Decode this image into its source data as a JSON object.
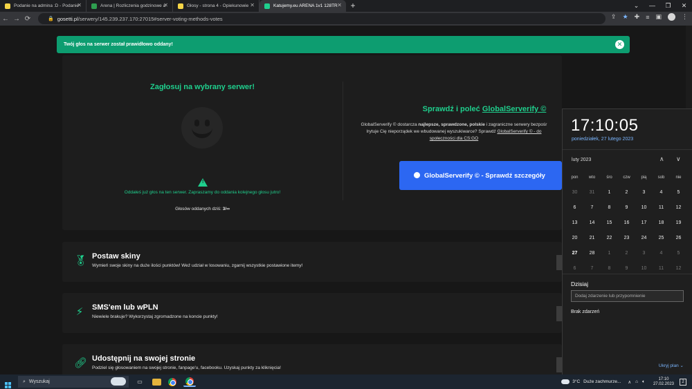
{
  "browser": {
    "tabs": [
      {
        "title": "Podanie na admina :D - Podanie",
        "favicon_color": "#f5d547",
        "active": false
      },
      {
        "title": "Arena | Rozliczenia godzinowe a",
        "favicon_color": "#2e9e4f",
        "active": false
      },
      {
        "title": "Głosy - strona 4 - Opiekunowie",
        "favicon_color": "#f5d547",
        "active": false
      },
      {
        "title": "Katujemy.eu ARENA 1v1 128TR",
        "favicon_color": "#1fcf8d",
        "active": true
      }
    ],
    "new_tab": "+",
    "url_host": "gosetti.pl",
    "url_path": "/serwery/145.239.237.170:27015#server-voting-methods-votes"
  },
  "notice": {
    "text": "Twój głos na serwer został prawidłowo oddany!",
    "close": "✕"
  },
  "vote": {
    "heading": "Zagłosuj na wybrany serwer!",
    "already_voted": "Oddałeś już głos na ten serwer. Zapraszamy do oddania kolejnego głosu jutro!",
    "count_label": "Głosów oddanych dziś:",
    "count_value": "3/∞",
    "warn_symbol": "!"
  },
  "globalserverify": {
    "title_prefix": "Sprawdź i poleć",
    "title_link": "GlobalServerify ©",
    "desc_line1_a": "GlobalServerify © dostarcza ",
    "desc_line1_b": "najlepsze, sprawdzone, polskie",
    "desc_line1_c": " i zagraniczne serwery bezpośr",
    "desc_line2_a": "Irytuje Cię nieporządek we wbudowanej wyszukiwarce? Sprawdź ",
    "desc_line2_b": "GlobalServerify © - do",
    "desc_line3": "społeczności dla CS:GO",
    "button": "GlobalServerify © - Sprawdź szczegóły"
  },
  "features": [
    {
      "title": "Postaw skiny",
      "desc": "Wymień swoje skiny na duże ilości punktów! Weź udział w losowaniu, zgarnij wszystkie postawione itemy!",
      "icon": "award-icon"
    },
    {
      "title": "SMS'em lub wPLN",
      "desc": "Niewiele brakuje? Wykorzystaj zgromadzone na koncie punkty!",
      "icon": "lightning-icon"
    },
    {
      "title": "Udostępnij na swojej stronie",
      "desc": "Podziel się głosowaniem na swojej stronie, fanpage'u, facebooku. Uzyskaj punkty za kliknięcia!",
      "icon": "link-icon"
    }
  ],
  "calendar_flyout": {
    "time": "17:10:05",
    "date": "poniedziałek, 27 lutego 2023",
    "month": "luty 2023",
    "weekdays": [
      "pon",
      "wto",
      "śro",
      "czw",
      "pią",
      "sob",
      "nie"
    ],
    "weeks": [
      [
        "30",
        "31",
        "1",
        "2",
        "3",
        "4",
        "5"
      ],
      [
        "6",
        "7",
        "8",
        "9",
        "10",
        "11",
        "12"
      ],
      [
        "13",
        "14",
        "15",
        "16",
        "17",
        "18",
        "19"
      ],
      [
        "20",
        "21",
        "22",
        "23",
        "24",
        "25",
        "26"
      ],
      [
        "27",
        "28",
        "1",
        "2",
        "3",
        "4",
        "5"
      ],
      [
        "6",
        "7",
        "8",
        "9",
        "10",
        "11",
        "12"
      ]
    ],
    "today_label": "Dzisiaj",
    "event_placeholder": "Dodaj zdarzenie lub przypomnienie",
    "no_events": "Brak zdarzeń",
    "hide_plan": "Ukryj plan"
  },
  "taskbar": {
    "search_placeholder": "Wyszukaj",
    "weather_temp": "3°C",
    "weather_desc": "Duże zachmurze...",
    "clock_time": "17:10",
    "clock_date": "27.02.2023"
  }
}
